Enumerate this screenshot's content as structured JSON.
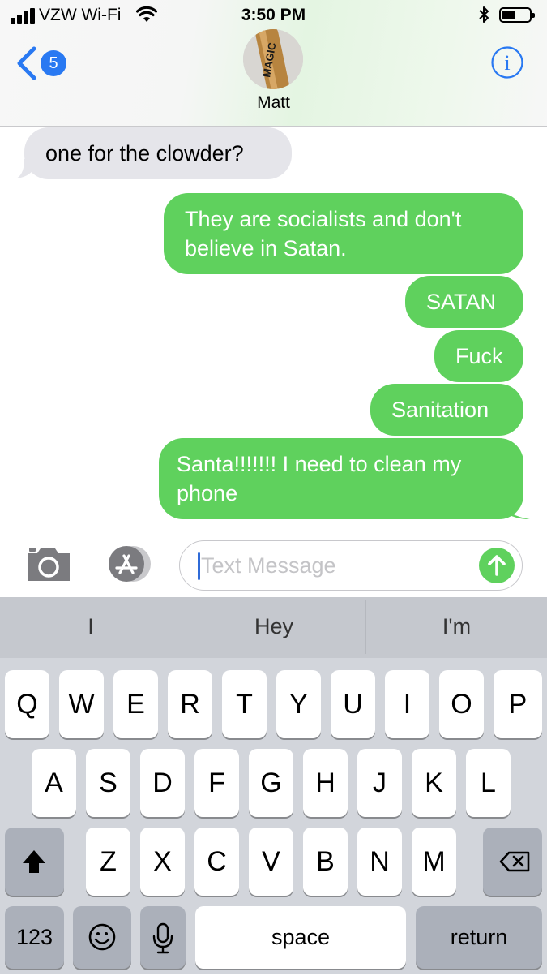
{
  "status_bar": {
    "carrier": "VZW Wi-Fi",
    "time": "3:50 PM"
  },
  "nav": {
    "back_badge": "5",
    "contact_name": "Matt",
    "avatar_text": "MAGIC"
  },
  "messages": [
    {
      "direction": "incoming",
      "text": "one for the clowder?"
    },
    {
      "direction": "outgoing",
      "text": "They are socialists and don't believe in Satan."
    },
    {
      "direction": "outgoing",
      "text": "SATAN"
    },
    {
      "direction": "outgoing",
      "text": "Fuck"
    },
    {
      "direction": "outgoing",
      "text": "Sanitation"
    },
    {
      "direction": "outgoing",
      "text": "Santa!!!!!!! I need to clean my phone"
    }
  ],
  "composer": {
    "placeholder": "Text Message"
  },
  "keyboard": {
    "suggestions": [
      "I",
      "Hey",
      "I'm"
    ],
    "row1": [
      "Q",
      "W",
      "E",
      "R",
      "T",
      "Y",
      "U",
      "I",
      "O",
      "P"
    ],
    "row2": [
      "A",
      "S",
      "D",
      "F",
      "G",
      "H",
      "J",
      "K",
      "L"
    ],
    "row3": [
      "Z",
      "X",
      "C",
      "V",
      "B",
      "N",
      "M"
    ],
    "numbers_label": "123",
    "space_label": "space",
    "return_label": "return"
  },
  "colors": {
    "outgoing_bubble": "#5fd15d",
    "incoming_bubble": "#e5e5ea",
    "ios_blue": "#2979f2",
    "keyboard_bg": "#d2d5db"
  },
  "icons": [
    "signal-icon",
    "wifi-icon",
    "bluetooth-icon",
    "battery-icon",
    "back-chevron-icon",
    "info-icon",
    "camera-icon",
    "app-store-icon",
    "send-arrow-icon",
    "shift-icon",
    "backspace-icon",
    "emoji-icon",
    "microphone-icon"
  ]
}
